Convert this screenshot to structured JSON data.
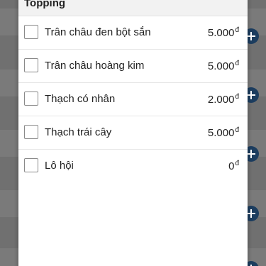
{
  "dialog": {
    "title": "Topping"
  },
  "toppings": [
    {
      "name": "Trân châu đen bột sắn",
      "price": "5.000",
      "currency": "đ",
      "checked": false
    },
    {
      "name": "Trân châu hoàng kim",
      "price": "5.000",
      "currency": "đ",
      "checked": false
    },
    {
      "name": "Thạch có nhân",
      "price": "2.000",
      "currency": "đ",
      "checked": false
    },
    {
      "name": "Thạch trái cây",
      "price": "5.000",
      "currency": "đ",
      "checked": false
    },
    {
      "name": "Lô hội",
      "price": "0",
      "currency": "đ",
      "checked": false
    }
  ],
  "background": {
    "add_icon": "plus-circle-icon",
    "overlay_color": "#707070",
    "accent_color": "#1c3d5f"
  }
}
